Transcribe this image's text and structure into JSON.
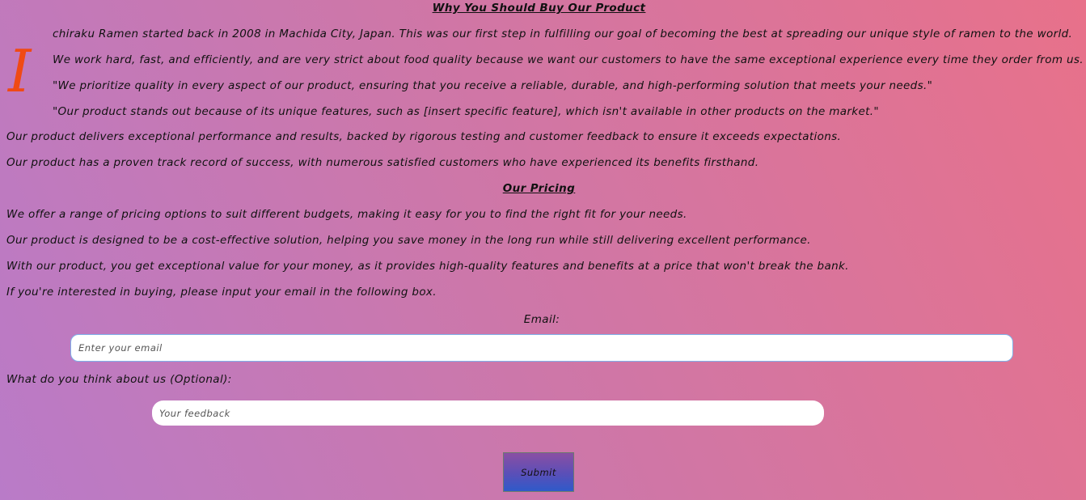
{
  "section_why": {
    "heading": "Why You Should Buy Our Product",
    "dropcap": "I",
    "paragraphs": [
      "chiraku Ramen started back in 2008 in Machida City, Japan. This was our first step in fulfilling our goal of becoming the best at spreading our unique style of ramen to the world.",
      "We work hard, fast, and efficiently, and are very strict about food quality because we want our customers to have the same exceptional experience every time they order from us.",
      "\"We prioritize quality in every aspect of our product, ensuring that you receive a reliable, durable, and high-performing solution that meets your needs.\"",
      "\"Our product stands out because of its unique features, such as [insert specific feature], which isn't available in other products on the market.\"",
      "Our product delivers exceptional performance and results, backed by rigorous testing and customer feedback to ensure it exceeds expectations.",
      "Our product has a proven track record of success, with numerous satisfied customers who have experienced its benefits firsthand."
    ]
  },
  "section_pricing": {
    "heading": "Our Pricing",
    "paragraphs": [
      "We offer a range of pricing options to suit different budgets, making it easy for you to find the right fit for your needs.",
      "Our product is designed to be a cost-effective solution, helping you save money in the long run while still delivering excellent performance.",
      "With our product, you get exceptional value for your money, as it provides high-quality features and benefits at a price that won't break the bank.",
      "If you're interested in buying, please input your email in the following box."
    ]
  },
  "form": {
    "email_label": "Email:",
    "email_placeholder": "Enter your email",
    "email_value": "",
    "feedback_label": "What do you think about us (Optional):",
    "feedback_placeholder": "Your feedback",
    "feedback_value": "",
    "submit_label": "Submit"
  },
  "colors": {
    "dropcap": "#f04a14",
    "input_border": "#7fb1ea",
    "submit_gradient_top": "#8a4fa3",
    "submit_gradient_bottom": "#2f5ac9"
  }
}
